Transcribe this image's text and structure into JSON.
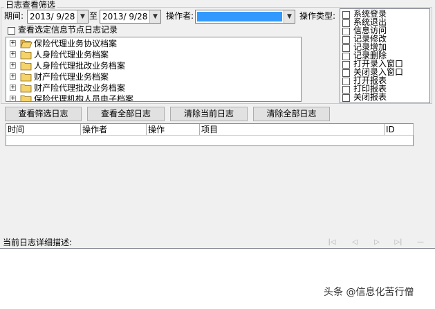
{
  "filter": {
    "group_title": "日志查看筛选",
    "period_label": "期间:",
    "date_from": "2013/ 9/28",
    "to_label": "至",
    "date_to": "2013/ 9/28",
    "operator_label": "操作者:",
    "operator_value": "",
    "type_label": "操作类型:",
    "node_checkbox_label": "查看选定信息节点日志记录"
  },
  "tree": {
    "items": [
      {
        "label": "保险代理业务协议档案",
        "expander": "+",
        "icon": "folder-open-icon"
      },
      {
        "label": "人身险代理业务档案",
        "expander": "+",
        "icon": "folder-icon"
      },
      {
        "label": "人身险代理批改业务档案",
        "expander": "+",
        "icon": "folder-icon"
      },
      {
        "label": "财产险代理业务档案",
        "expander": "+",
        "icon": "folder-icon"
      },
      {
        "label": "财产险代理批改业务档案",
        "expander": "+",
        "icon": "folder-icon"
      },
      {
        "label": "保险代理机构人员电子档案",
        "expander": "+",
        "icon": "folder-icon"
      }
    ]
  },
  "types": {
    "items": [
      {
        "label": "系统登录"
      },
      {
        "label": "系统退出"
      },
      {
        "label": "信息访问"
      },
      {
        "label": "记录修改"
      },
      {
        "label": "记录增加"
      },
      {
        "label": "记录删除"
      },
      {
        "label": "打开录入窗口"
      },
      {
        "label": "关闭录入窗口"
      },
      {
        "label": "打开报表"
      },
      {
        "label": "打印报表"
      },
      {
        "label": "关闭报表"
      }
    ]
  },
  "buttons": {
    "view_filtered": "查看筛选日志",
    "view_all": "查看全部日志",
    "clear_current": "清除当前日志",
    "clear_all": "清除全部日志"
  },
  "grid": {
    "columns": [
      "时间",
      "操作者",
      "操作",
      "项目",
      "ID"
    ]
  },
  "detail": {
    "label": "当前日志详细描述:",
    "nav_icons": [
      "first-icon",
      "prev-icon",
      "next-icon",
      "last-icon",
      "minimize-icon"
    ]
  },
  "watermark": "头条 @信息化苦行僧",
  "colors": {
    "selection": "#3399ff",
    "folder": "#f5d36b"
  }
}
